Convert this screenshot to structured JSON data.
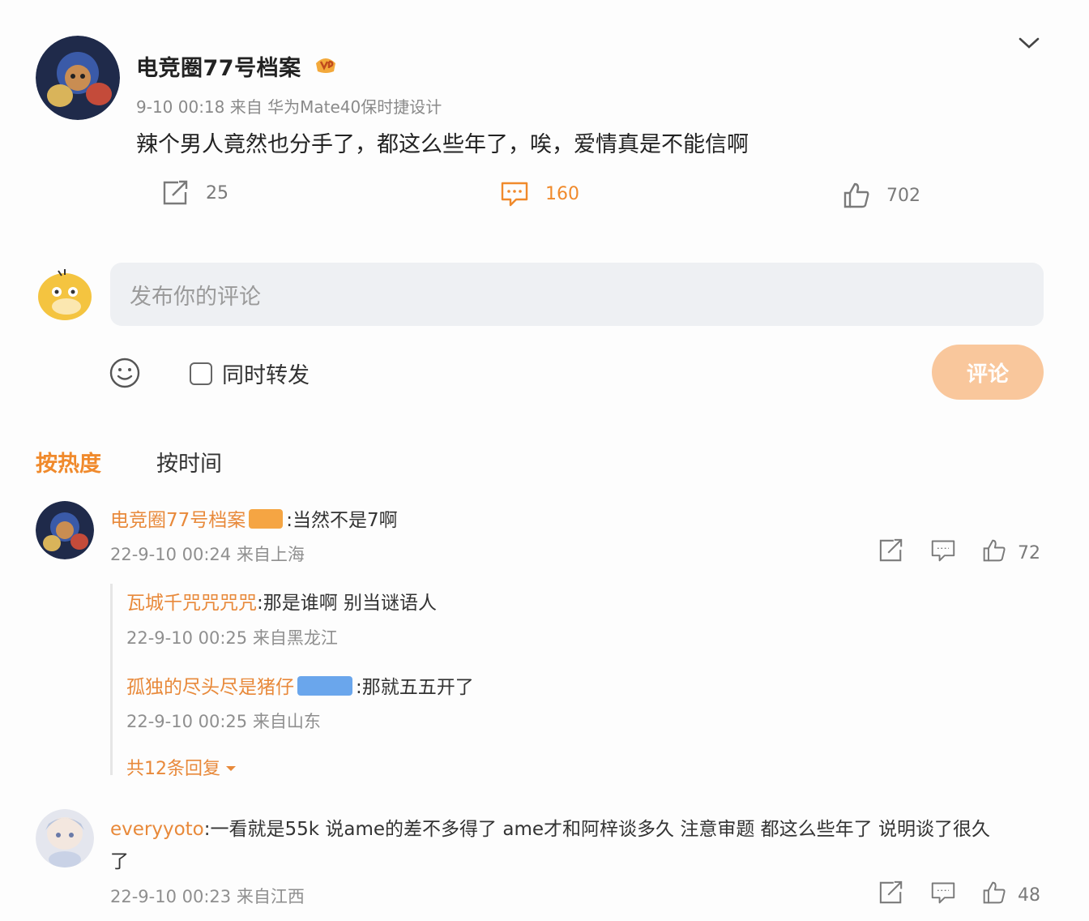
{
  "post": {
    "author": "电竞圈77号档案",
    "meta": "9-10 00:18  来自  华为Mate40保时捷设计",
    "text": "辣个男人竟然也分手了，都这么些年了，唉，爱情真是不能信啊",
    "repost_count": "25",
    "comment_count": "160",
    "like_count": "702"
  },
  "composer": {
    "placeholder": "发布你的评论",
    "repost_label": "同时转发",
    "submit_label": "评论"
  },
  "sort_tabs": {
    "hot": "按热度",
    "time": "按时间"
  },
  "comments": [
    {
      "user": "电竞圈77号档案",
      "text": ":当然不是7啊",
      "meta": "22-9-10 00:24 来自上海",
      "likes": "72",
      "replies": [
        {
          "user": "瓦城千咒咒咒咒",
          "text": ":那是谁啊 别当谜语人",
          "meta": "22-9-10 00:25 来自黑龙江"
        },
        {
          "user": "孤独的尽头尽是猪仔",
          "text": ":那就五五开了",
          "meta": "22-9-10 00:25 来自山东"
        }
      ],
      "more_replies": "共12条回复"
    },
    {
      "user": "everyyoto",
      "text_line1": ":一看就是55k 说ame的差不多得了 ame才和阿梓谈多久 注意审题 都这么些年了 说明谈了很久",
      "text_line2": "了",
      "meta": "22-9-10 00:23 来自江西",
      "likes": "48"
    }
  ],
  "colors": {
    "accent": "#f08a2c",
    "username": "#e8893a",
    "submit_disabled": "#f9c79c",
    "input_bg": "#eef0f3"
  }
}
